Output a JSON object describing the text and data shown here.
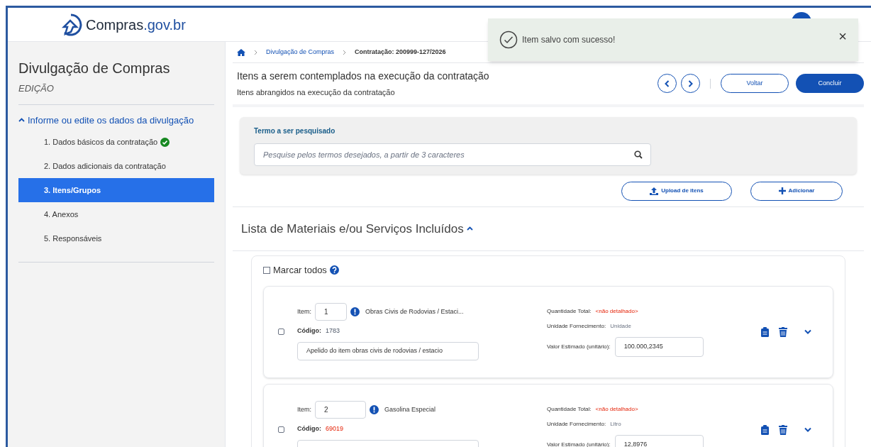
{
  "header": {
    "logo_text": "Compras",
    "logo_domain": ".gov.br"
  },
  "toast": {
    "message": "Item salvo com sucesso!",
    "close": "×"
  },
  "sidebar": {
    "title": "Divulgação de Compras",
    "subtitle": "EDIÇÃO",
    "section": {
      "label": "Informe ou edite os dados da divulgação",
      "expanded": true
    },
    "items": [
      {
        "label": "1. Dados básicos da contratação",
        "completed": true,
        "selected": false
      },
      {
        "label": "2. Dados adicionais da contratação",
        "completed": false,
        "selected": false
      },
      {
        "label": "3. Itens/Grupos",
        "completed": false,
        "selected": true
      },
      {
        "label": "4. Anexos",
        "completed": false,
        "selected": false
      },
      {
        "label": "5. Responsáveis",
        "completed": false,
        "selected": false
      }
    ]
  },
  "breadcrumb": [
    "Divulgação de Compras",
    "Contratação: 200999-127/2026"
  ],
  "page": {
    "title": "Itens a serem contemplados na execução da contratação",
    "subtitle": "Itens abrangidos na execução da contratação",
    "buttons": [
      "Voltar",
      "Concluir"
    ]
  },
  "search": {
    "label": "Termo a ser pesquisado",
    "placeholder": "Pesquise pelos termos desejados, a partir de 3 caracteres"
  },
  "actions": [
    "Upload de itens",
    "Adicionar"
  ],
  "list": {
    "title": "Lista de Materiais e/ou Serviços Incluídos",
    "expanded": true,
    "select_all": {
      "label": "Marcar todos",
      "checked": false
    },
    "items": [
      {
        "checked": false,
        "item_label": "Item:",
        "number": "1",
        "description": "Obras Civis de Rodovias / Estaci...",
        "code_label": "Código:",
        "code": "1783",
        "code_error": false,
        "nickname": "Apelido do item obras civis de rodovias / estacio",
        "qty_label": "Quantidade Total:",
        "qty": "<não detalhado>",
        "unit_label": "Unidade Fornecimento:",
        "unit": "Unidade",
        "value_label": "Valor Estimado (unitário):",
        "value": "100.000,2345"
      },
      {
        "checked": false,
        "item_label": "Item:",
        "number": "2",
        "description": "Gasolina Especial",
        "code_label": "Código:",
        "code": "69019",
        "code_error": true,
        "qty_label": "Quantidade Total:",
        "qty": "<não detalhado>",
        "unit_label": "Unidade Fornecimento:",
        "unit": "Litro",
        "value_label": "Valor Estimado (unitário):",
        "value": "12,8976"
      }
    ]
  }
}
